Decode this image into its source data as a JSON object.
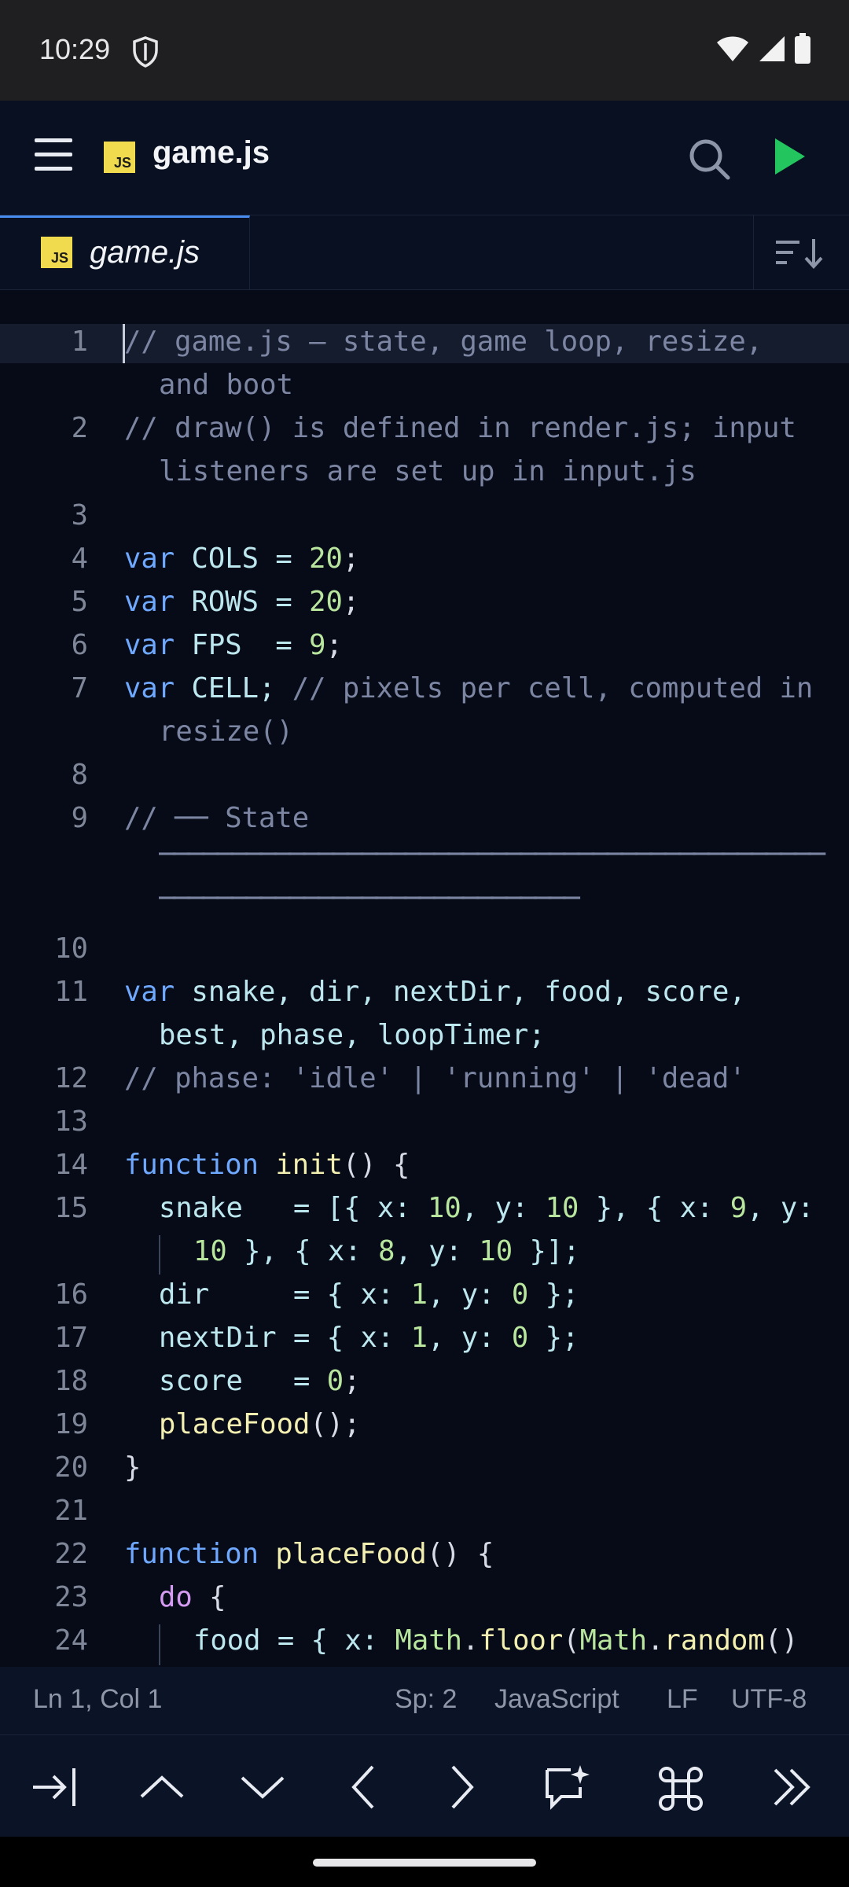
{
  "status_bar": {
    "time": "10:29"
  },
  "app_bar": {
    "file_title": "game.js",
    "file_badge": "JS"
  },
  "tabs": [
    {
      "label": "game.js",
      "badge": "JS",
      "active": true
    }
  ],
  "editor": {
    "line_numbers": [
      "1",
      "2",
      "3",
      "4",
      "5",
      "6",
      "7",
      "8",
      "9",
      "10",
      "11",
      "12",
      "13",
      "14",
      "15",
      "16",
      "17",
      "18",
      "19",
      "20",
      "21",
      "22",
      "23",
      "24"
    ],
    "line1": "// game.js — state, game loop, resize,",
    "line1b": "and boot",
    "line2": "// draw() is defined in render.js; input",
    "line2b": "listeners are set up in input.js",
    "line4": [
      "var",
      " COLS = ",
      "20",
      ";"
    ],
    "line5": [
      "var",
      " ROWS = ",
      "20",
      ";"
    ],
    "line6": [
      "var",
      " FPS  = ",
      "9",
      ";"
    ],
    "line7": [
      "var",
      " CELL; ",
      "// pixels per cell, computed in"
    ],
    "line7b": "resize()",
    "line9": "// ── State",
    "line9b": "──────────────────────────────────────────────",
    "line9c": "─────────────────────────────",
    "line11": [
      "var",
      " snake, dir, nextDir, food, score,"
    ],
    "line11b": "best, phase, loopTimer;",
    "line12": "// phase: 'idle' | 'running' | 'dead'",
    "line14": [
      "function",
      " ",
      "init",
      "() {"
    ],
    "line15": [
      "snake   = [{ x: ",
      "10",
      ", y: ",
      "10",
      " }, { x: ",
      "9",
      ", y:"
    ],
    "line15b": [
      "10",
      " }, { x: ",
      "8",
      ", y: ",
      "10",
      " }];"
    ],
    "line16": [
      "dir     = { x: ",
      "1",
      ", y: ",
      "0",
      " };"
    ],
    "line17": [
      "nextDir = { x: ",
      "1",
      ", y: ",
      "0",
      " };"
    ],
    "line18": [
      "score   = ",
      "0",
      ";"
    ],
    "line19": [
      "placeFood",
      "();"
    ],
    "line20": "}",
    "line22": [
      "function",
      " ",
      "placeFood",
      "() {"
    ],
    "line23": [
      "do",
      " {"
    ],
    "line24": [
      "food = { x: ",
      "Math",
      ".",
      "floor",
      "(",
      "Math",
      ".",
      "random",
      "()"
    ]
  },
  "status_line": {
    "position": "Ln 1, Col 1",
    "spaces": "Sp: 2",
    "language": "JavaScript",
    "line_ending": "LF",
    "encoding": "UTF-8"
  },
  "toolbar_icons": [
    "tab-icon",
    "arrow-up-icon",
    "arrow-down-icon",
    "arrow-left-icon",
    "arrow-right-icon",
    "ai-chat-icon",
    "command-icon",
    "more-icon"
  ],
  "colors": {
    "accent": "#4a8df0",
    "run": "#22c55e",
    "js_badge": "#f0db4f",
    "background": "#060b17"
  }
}
